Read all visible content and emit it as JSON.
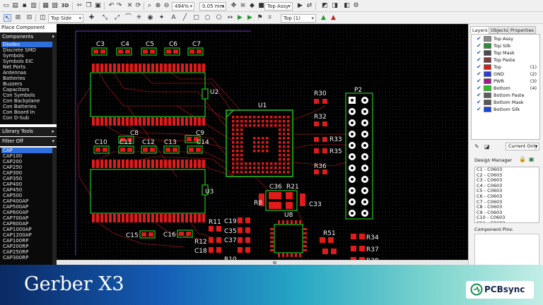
{
  "toolbar": {
    "zoom": "494%",
    "grid": "0.05 mm",
    "layer_view": "Top Assy",
    "side": "Top Side",
    "active_layer": "Top (1)",
    "three_d": "3D"
  },
  "left_panel": {
    "place_component": "Place Component",
    "components": "Components",
    "library_tools": "Library Tools",
    "filter": "Filter Off",
    "categories": [
      "Diodes",
      "Discrete SMD",
      "Symbols",
      "Symbols EIC",
      "Net Ports",
      "Antennas",
      "Batteries",
      "Buzzers",
      "Capacitors",
      "Con Symbols",
      "Con Backplane",
      "Con Batteries",
      "Con Board In",
      "Con D-Sub"
    ],
    "selected_category": "Diodes",
    "parts": [
      "CAP",
      "CAP100",
      "CAP200",
      "CAP250",
      "CAP300",
      "CAP350",
      "CAP400",
      "CAP450",
      "CAP500",
      "CAP400AP",
      "CAP500AP",
      "CAP600AP",
      "CAP700AP",
      "CAP800AP",
      "CAP1000AP",
      "CAP1200AP",
      "CAP100RP",
      "CAP200RP",
      "CAP250RP",
      "CAP300RP"
    ],
    "selected_part": "CAP"
  },
  "pcb": {
    "caps_top": [
      "C3",
      "C4",
      "C5",
      "C6",
      "C7"
    ],
    "u2": "U2",
    "u1": "U1",
    "u3": "U3",
    "u8": "U8",
    "p2": "P2",
    "mid_caps": [
      "C8",
      "C9",
      "C10",
      "C11",
      "C12",
      "C13",
      "C14"
    ],
    "resistors_right": [
      "R30",
      "R32",
      "R33",
      "R35",
      "R36"
    ],
    "lower_labels": [
      "C36",
      "R21",
      "R8",
      "C33"
    ],
    "bottom_left": [
      "C15",
      "C16"
    ],
    "bottom_mid": [
      "R11",
      "C19",
      "C35",
      "C37",
      "R12",
      "C18",
      "R10"
    ],
    "bottom_right": [
      "R51",
      "R34",
      "R37",
      "R38"
    ]
  },
  "right_panel": {
    "tabs": [
      "Layers",
      "Objects",
      "Properties"
    ],
    "layers": [
      {
        "name": "Top Assy",
        "color": "#8c8c8c",
        "count": ""
      },
      {
        "name": "Top Silk",
        "color": "#2e8b3c",
        "count": ""
      },
      {
        "name": "Top Mask",
        "color": "#4a4a4a",
        "count": ""
      },
      {
        "name": "Top Paste",
        "color": "#7a3d3d",
        "count": ""
      },
      {
        "name": "Top",
        "color": "#d41f1f",
        "count": "(1)"
      },
      {
        "name": "GND",
        "color": "#2a3fd8",
        "count": "(2)"
      },
      {
        "name": "PWR",
        "color": "#a4168f",
        "count": "(3)"
      },
      {
        "name": "Bottom",
        "color": "#21c91f",
        "count": "(4)"
      },
      {
        "name": "Bottom Paste",
        "color": "#5c5c5c",
        "count": ""
      },
      {
        "name": "Bottom Mask",
        "color": "#555",
        "count": ""
      },
      {
        "name": "Bottom Silk",
        "color": "#1646e0",
        "count": ""
      }
    ],
    "view_mode": "Current Only",
    "design_manager": "Design Manager",
    "dm_items": [
      "C1 - C0603",
      "C2 - C0603",
      "C3 - C0603",
      "C4 - C0603",
      "C5 - C0603",
      "C6 - C0603",
      "C7 - C0603",
      "C8 - C0603",
      "C9 - C0603",
      "C10 - C0603",
      "C11 - C0603",
      "C12 - C0603",
      "C13 - C0603"
    ],
    "component_pins": "Component Pins:"
  },
  "footer": {
    "title": "Gerber X3",
    "brand": "PCBsync"
  }
}
